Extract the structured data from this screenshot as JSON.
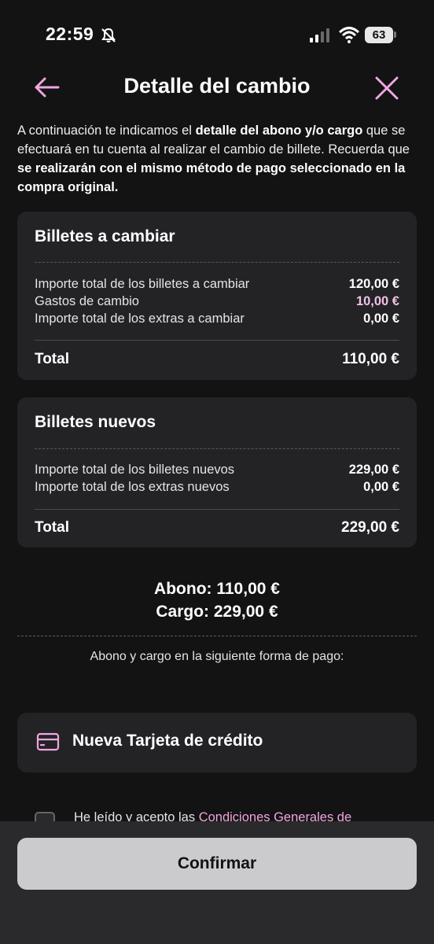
{
  "status_bar": {
    "time": "22:59",
    "battery": "63",
    "icons": [
      "bell-muted-icon",
      "signal-icon",
      "wifi-icon",
      "battery-icon"
    ]
  },
  "header": {
    "title": "Detalle del cambio",
    "back_icon": "arrow-left-icon",
    "close_icon": "close-icon",
    "accent_color": "#f0a6e0"
  },
  "intro": {
    "p1": "A continuación te indicamos el ",
    "b1": "detalle del abono y/o cargo",
    "p2": " que se efectuará en tu cuenta al realizar el cambio de billete. Recuerda que ",
    "b2": "se realizarán con el mismo método de pago seleccionado en la compra original."
  },
  "old_tickets": {
    "title": "Billetes a cambiar",
    "rows": [
      {
        "label": "Importe total de los billetes a cambiar",
        "value": "120,00 €"
      },
      {
        "label": "Gastos de cambio",
        "value": "10,00 €"
      },
      {
        "label": "Importe total de los extras a cambiar",
        "value": "0,00 €"
      }
    ],
    "total_label": "Total",
    "total_value": "110,00 €"
  },
  "new_tickets": {
    "title": "Billetes nuevos",
    "rows": [
      {
        "label": "Importe total de los billetes nuevos",
        "value": "229,00 €"
      },
      {
        "label": "Importe total de los extras nuevos",
        "value": "0,00 €"
      }
    ],
    "total_label": "Total",
    "total_value": "229,00 €"
  },
  "summary": {
    "abono": "Abono: 110,00 €",
    "cargo": "Cargo: 229,00 €",
    "payment_info": "Abono y cargo en la siguiente forma de pago:"
  },
  "payment_method": {
    "icon": "credit-card-icon",
    "label": "Nueva Tarjeta de crédito"
  },
  "terms": {
    "text": "He leído y acepto las ",
    "link": "Condiciones Generales de"
  },
  "confirm_label": "Confirmar"
}
